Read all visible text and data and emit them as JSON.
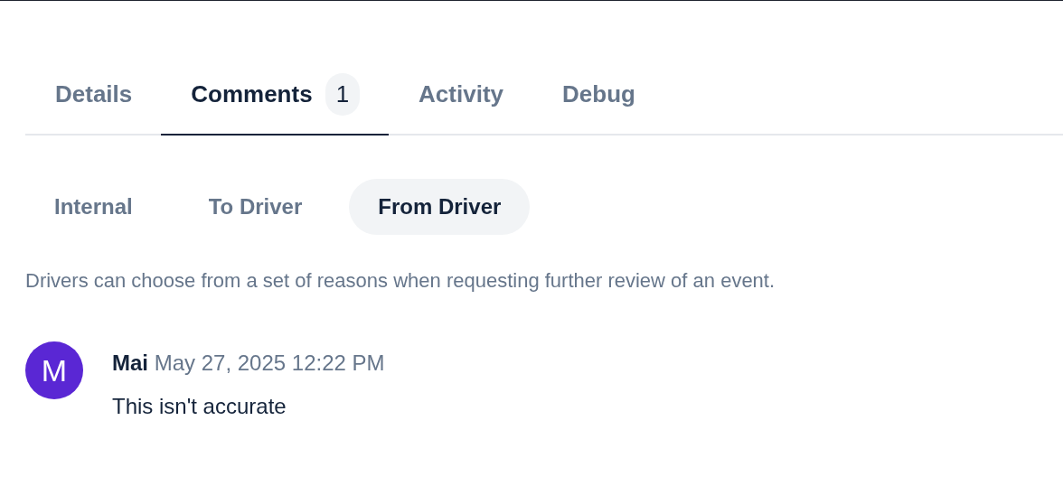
{
  "tabs": [
    {
      "label": "Details",
      "selected": false
    },
    {
      "label": "Comments",
      "selected": true,
      "count": "1"
    },
    {
      "label": "Activity",
      "selected": false
    },
    {
      "label": "Debug",
      "selected": false
    }
  ],
  "subtabs": [
    {
      "label": "Internal",
      "selected": false
    },
    {
      "label": "To Driver",
      "selected": false
    },
    {
      "label": "From Driver",
      "selected": true
    }
  ],
  "description": "Drivers can choose from a set of reasons when requesting further review of an event.",
  "comments": [
    {
      "initial": "M",
      "author": "Mai",
      "time": "May 27, 2025 12:22 PM",
      "text": "This isn't accurate"
    }
  ]
}
